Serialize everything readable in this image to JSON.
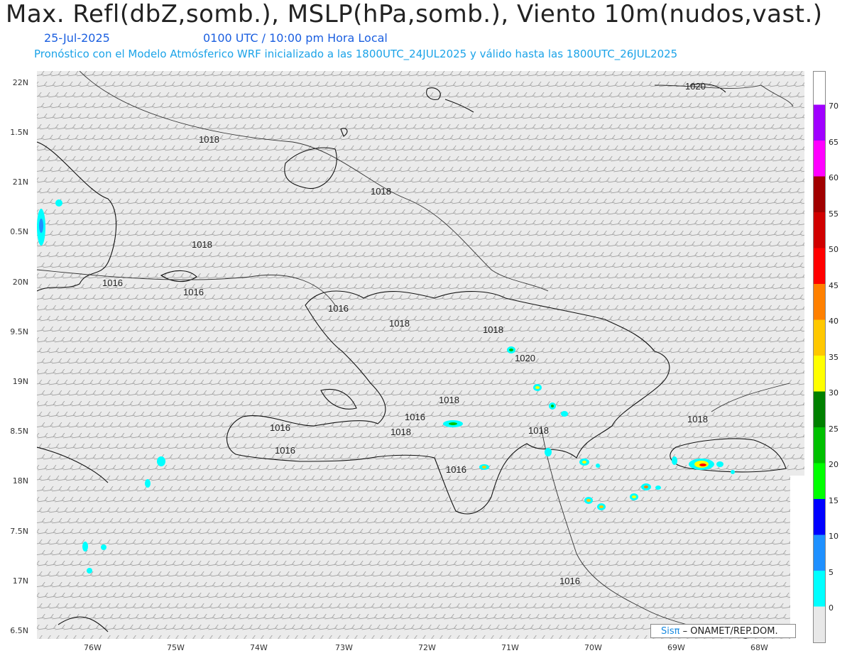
{
  "header": {
    "title": "Max. Refl(dbZ,somb.), MSLP(hPa,somb.), Viento 10m(nudos,vast.)",
    "date": "25-Jul-2025",
    "time": "0100 UTC / 10:00 pm Hora Local",
    "forecast_line": "Pronóstico con el Modelo Atmósferico WRF inicializado a las 1800UTC_24JUL2025 y válido hasta las  1800UTC_26JUL2025"
  },
  "axes": {
    "lat_labels": [
      "22N",
      "1.5N",
      "21N",
      "0.5N",
      "20N",
      "9.5N",
      "19N",
      "8.5N",
      "18N",
      "7.5N",
      "17N",
      "6.5N"
    ],
    "lon_labels": [
      "76W",
      "75W",
      "74W",
      "73W",
      "72W",
      "71W",
      "70W",
      "69W",
      "68W"
    ]
  },
  "isobars": [
    {
      "label": "1020"
    },
    {
      "label": "1018"
    },
    {
      "label": "1018"
    },
    {
      "label": "1018"
    },
    {
      "label": "1016"
    },
    {
      "label": "1016"
    },
    {
      "label": "1016"
    },
    {
      "label": "1018"
    },
    {
      "label": "1018"
    },
    {
      "label": "1020"
    },
    {
      "label": "1018"
    },
    {
      "label": "1016"
    },
    {
      "label": "1018"
    },
    {
      "label": "1016"
    },
    {
      "label": "1016"
    },
    {
      "label": "1018"
    },
    {
      "label": "1018"
    },
    {
      "label": "1016"
    },
    {
      "label": "1016"
    }
  ],
  "colorbar": {
    "levels": [
      "70",
      "65",
      "60",
      "55",
      "50",
      "45",
      "40",
      "35",
      "30",
      "25",
      "20",
      "15",
      "10",
      "5",
      "0"
    ],
    "colors": [
      "#e8e8e8",
      "#00ffff",
      "#1e90ff",
      "#0000ff",
      "#00ff00",
      "#00c000",
      "#008000",
      "#ffff00",
      "#ffc800",
      "#ff8000",
      "#ff0000",
      "#d00000",
      "#a00000",
      "#ff00ff",
      "#a000ff"
    ]
  },
  "credit": {
    "brand": "Sisπ",
    "org": " – ONAMET/REP.DOM."
  },
  "colors": {
    "map_bg": "#ebebeb",
    "wind": "#666666",
    "coast": "#111111",
    "title_blue": "#1b5fe0",
    "subtitle_cyan": "#1ba3e8"
  }
}
